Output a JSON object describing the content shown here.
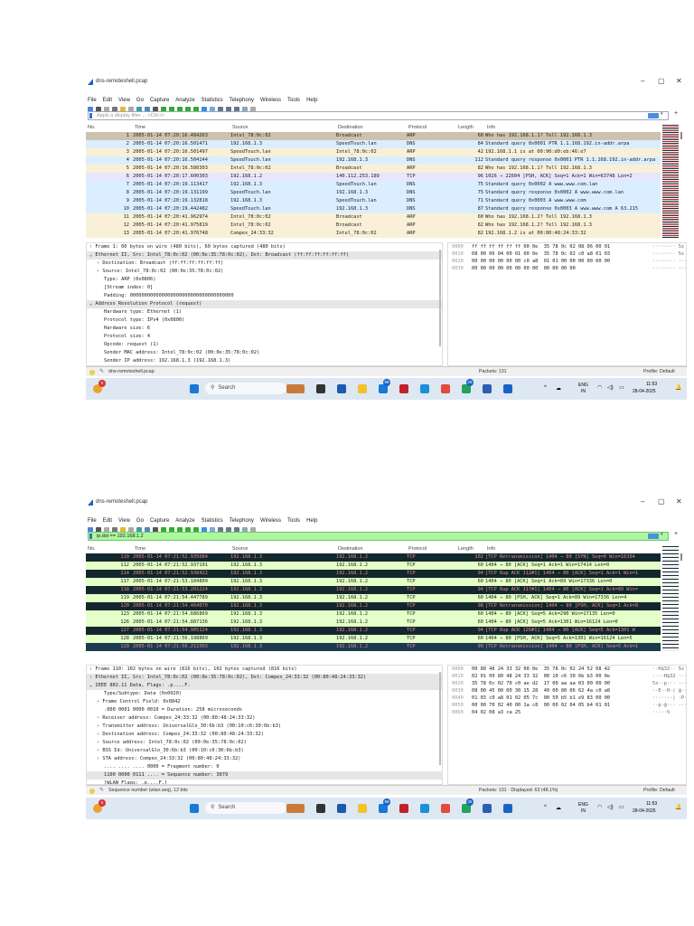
{
  "windows": [
    {
      "title": "dns-remoteshell.pcap",
      "menu": [
        "File",
        "Edit",
        "View",
        "Go",
        "Capture",
        "Analyze",
        "Statistics",
        "Telephony",
        "Wireless",
        "Tools",
        "Help"
      ],
      "filter": {
        "value": "",
        "placeholder": "Apply a display filter ... <Ctrl-/>",
        "active": false
      },
      "columns": [
        "No.",
        "Time",
        "Source",
        "Destination",
        "Protocol",
        "Length",
        "Info"
      ],
      "rows": [
        {
          "no": "1",
          "time": "2005-01-14 07:20:16.484263",
          "src": "Intel_78:0c:02",
          "dst": "Broadcast",
          "proto": "ARP",
          "len": "60",
          "info": "Who has 192.168.1.1? Tell 192.168.1.3",
          "style": "sel1"
        },
        {
          "no": "2",
          "time": "2005-01-14 07:20:16.501471",
          "src": "192.168.1.3",
          "dst": "SpeedTouch.lan",
          "proto": "DNS",
          "len": "84",
          "info": "Standard query 0x0001 PTR 1.1.168.192.in-addr.arpa",
          "style": "dns"
        },
        {
          "no": "3",
          "time": "2005-01-14 07:20:16.501497",
          "src": "SpeedTouch.lan",
          "dst": "Intel_78:0c:02",
          "proto": "ARP",
          "len": "42",
          "info": "192.168.1.1 is at 00:90:d0:eb:46:e7",
          "style": "arp"
        },
        {
          "no": "4",
          "time": "2005-01-14 07:20:16.504144",
          "src": "SpeedTouch.lan",
          "dst": "192.168.1.3",
          "proto": "DNS",
          "len": "112",
          "info": "Standard query response 0x0001 PTR 1.1.168.192.in-addr.arpa",
          "style": "dns"
        },
        {
          "no": "5",
          "time": "2005-01-14 07:20:16.580303",
          "src": "Intel_78:0c:02",
          "dst": "Broadcast",
          "proto": "ARP",
          "len": "82",
          "info": "Who has 192.168.1.1? Tell 192.168.1.3",
          "style": "arp"
        },
        {
          "no": "6",
          "time": "2005-01-14 07:20:17.600303",
          "src": "192.168.1.2",
          "dst": "140.112.253.189",
          "proto": "TCP",
          "len": "96",
          "info": "1026 → 22604 [PSH, ACK] Seq=1 Ack=1 Win=63748 Len=2",
          "style": "tcp"
        },
        {
          "no": "7",
          "time": "2005-01-14 07:20:19.113417",
          "src": "192.168.1.3",
          "dst": "SpeedTouch.lan",
          "proto": "DNS",
          "len": "75",
          "info": "Standard query 0x0002 A www.www.com.lan",
          "style": "dns"
        },
        {
          "no": "8",
          "time": "2005-01-14 07:20:19.131199",
          "src": "SpeedTouch.lan",
          "dst": "192.168.1.3",
          "proto": "DNS",
          "len": "75",
          "info": "Standard query response 0x0002 A www.www.com.lan",
          "style": "dns"
        },
        {
          "no": "9",
          "time": "2005-01-14 07:20:19.132818",
          "src": "192.168.1.3",
          "dst": "SpeedTouch.lan",
          "proto": "DNS",
          "len": "71",
          "info": "Standard query 0x0003 A www.www.com",
          "style": "dns"
        },
        {
          "no": "10",
          "time": "2005-01-14 07:20:19.442482",
          "src": "SpeedTouch.lan",
          "dst": "192.168.1.3",
          "proto": "DNS",
          "len": "87",
          "info": "Standard query response 0x0003 A www.www.com A 63.215",
          "style": "dns"
        },
        {
          "no": "11",
          "time": "2005-01-14 07:20:41.962974",
          "src": "Intel_78:0c:02",
          "dst": "Broadcast",
          "proto": "ARP",
          "len": "60",
          "info": "Who has 192.168.1.2? Tell 192.168.1.3",
          "style": "arp"
        },
        {
          "no": "12",
          "time": "2005-01-14 07:20:41.975819",
          "src": "Intel_78:0c:02",
          "dst": "Broadcast",
          "proto": "ARP",
          "len": "82",
          "info": "Who has 192.168.1.2? Tell 192.168.1.3",
          "style": "arp"
        },
        {
          "no": "13",
          "time": "2005-01-14 07:20:41.976748",
          "src": "Compex_24:33:32",
          "dst": "Intel_78:0c:02",
          "proto": "ARP",
          "len": "82",
          "info": "192.168.1.2 is at 00:80:48:24:33:32",
          "style": "arp"
        }
      ],
      "details": [
        {
          "t": "› Frame 1: 60 bytes on wire (480 bits), 60 bytes captured (480 bits)",
          "i": 0
        },
        {
          "t": "⌄ Ethernet II, Src: Intel_78:0c:02 (00:0e:35:78:0c:02), Dst: Broadcast (ff:ff:ff:ff:ff:ff)",
          "i": 0,
          "hl": true
        },
        {
          "t": "› Destination: Broadcast (ff:ff:ff:ff:ff:ff)",
          "i": 1
        },
        {
          "t": "› Source: Intel_78:0c:02 (00:0e:35:78:0c:02)",
          "i": 1
        },
        {
          "t": "Type: ARP (0x0806)",
          "i": 2
        },
        {
          "t": "[Stream index: 0]",
          "i": 2
        },
        {
          "t": "Padding: 000000000000000000000000000000000000",
          "i": 2
        },
        {
          "t": "⌄ Address Resolution Protocol (request)",
          "i": 0,
          "hl": true
        },
        {
          "t": "Hardware type: Ethernet (1)",
          "i": 2
        },
        {
          "t": "Protocol type: IPv4 (0x0800)",
          "i": 2
        },
        {
          "t": "Hardware size: 6",
          "i": 2
        },
        {
          "t": "Protocol size: 4",
          "i": 2
        },
        {
          "t": "Opcode: request (1)",
          "i": 2
        },
        {
          "t": "Sender MAC address: Intel_78:0c:02 (00:0e:35:78:0c:02)",
          "i": 2
        },
        {
          "t": "Sender IP address: 192.168.1.3 (192.168.1.3)",
          "i": 2
        }
      ],
      "hex": [
        {
          "off": "0000",
          "bytes": "ff ff ff ff ff ff 00 0e  35 78 0c 02 08 06 00 01",
          "ascii": "········ 5x"
        },
        {
          "off": "0010",
          "bytes": "08 00 06 04 00 01 00 0e  35 78 0c 02 c0 a8 01 03",
          "ascii": "········ 5x"
        },
        {
          "off": "0020",
          "bytes": "00 00 00 00 00 00 c0 a8  01 01 00 00 00 00 00 00",
          "ascii": "········ ···"
        },
        {
          "off": "0030",
          "bytes": "00 00 00 00 00 00 00 00  00 00 00 00",
          "ascii": "········ ···"
        }
      ],
      "status": {
        "left": "dns-remoteshell.pcap",
        "packets": "Packets: 131",
        "profile": "Profile: Default"
      },
      "taskbar": {
        "search": "Search",
        "lang1": "ENG",
        "lang2": "IN",
        "time": "11:53",
        "date": "28-04-2025",
        "badges": [
          "5",
          "99",
          "26"
        ]
      }
    },
    {
      "title": "dns-remoteshell.pcap",
      "menu": [
        "File",
        "Edit",
        "View",
        "Go",
        "Capture",
        "Analyze",
        "Statistics",
        "Telephony",
        "Wireless",
        "Tools",
        "Help"
      ],
      "filter": {
        "value": "ip.dst == 192.168.1.2",
        "placeholder": "",
        "active": true
      },
      "columns": [
        "No.",
        "Time",
        "Source",
        "Destination",
        "Protocol",
        "Length",
        "Info"
      ],
      "rows": [
        {
          "no": "110",
          "time": "2005-01-14 07:21:52.935084",
          "src": "192.168.1.3",
          "dst": "192.168.1.2",
          "proto": "TCP",
          "len": "102",
          "info": "[TCP Retransmission] 1404 → 80 [SYN] Seq=0 Win=16384",
          "style": "bad"
        },
        {
          "no": "112",
          "time": "2005-01-14 07:21:52.937191",
          "src": "192.168.1.3",
          "dst": "192.168.1.2",
          "proto": "TCP",
          "len": "60",
          "info": "1404 → 80 [ACK] Seq=1 Ack=1 Win=17414 Len=0",
          "style": "ok"
        },
        {
          "no": "114",
          "time": "2005-01-14 07:21:52.938422",
          "src": "192.168.1.3",
          "dst": "192.168.1.2",
          "proto": "TCP",
          "len": "94",
          "info": "[TCP Dup ACK 112#1] 1404 → 80 [ACK] Seq=1 Ack=1 Win=1",
          "style": "bad"
        },
        {
          "no": "117",
          "time": "2005-01-14 07:21:53.184809",
          "src": "192.168.1.3",
          "dst": "192.168.1.2",
          "proto": "TCP",
          "len": "60",
          "info": "1404 → 80 [ACK] Seq=1 Ack=89 Win=17336 Len=0",
          "style": "ok"
        },
        {
          "no": "118",
          "time": "2005-01-14 07:21:53.201224",
          "src": "192.168.1.3",
          "dst": "192.168.1.2",
          "proto": "TCP",
          "len": "94",
          "info": "[TCP Dup ACK 117#1] 1404 → 80 [ACK] Seq=1 Ack=89 Win=",
          "style": "bad"
        },
        {
          "no": "119",
          "time": "2005-01-14 07:21:54.447789",
          "src": "192.168.1.3",
          "dst": "192.168.1.2",
          "proto": "TCP",
          "len": "60",
          "info": "1404 → 80 [PSH, ACK] Seq=1 Ack=89 Win=17336 Len=4",
          "style": "ok"
        },
        {
          "no": "120",
          "time": "2005-01-14 07:21:54.464070",
          "src": "192.168.1.3",
          "dst": "192.168.1.2",
          "proto": "TCP",
          "len": "98",
          "info": "[TCP Retransmission] 1404 → 80 [PSH, ACK] Seq=1 Ack=8",
          "style": "bad"
        },
        {
          "no": "123",
          "time": "2005-01-14 07:21:54.686869",
          "src": "192.168.1.3",
          "dst": "192.168.1.2",
          "proto": "TCP",
          "len": "60",
          "info": "1404 → 80 [ACK] Seq=5 Ack=290 Win=17135 Len=0",
          "style": "ok"
        },
        {
          "no": "126",
          "time": "2005-01-14 07:21:54.887136",
          "src": "192.168.1.3",
          "dst": "192.168.1.2",
          "proto": "TCP",
          "len": "60",
          "info": "1404 → 80 [ACK] Seq=5 Ack=1301 Win=16124 Len=0",
          "style": "ok"
        },
        {
          "no": "127",
          "time": "2005-01-14 07:21:54.905124",
          "src": "192.168.1.3",
          "dst": "192.168.1.2",
          "proto": "TCP",
          "len": "94",
          "info": "[TCP Dup ACK 126#1] 1404 → 80 [ACK] Seq=5 Ack=1301 W",
          "style": "bad"
        },
        {
          "no": "128",
          "time": "2005-01-14 07:21:56.198869",
          "src": "192.168.1.3",
          "dst": "192.168.1.2",
          "proto": "TCP",
          "len": "60",
          "info": "1404 → 80 [PSH, ACK] Seq=5 Ack=1301 Win=16124 Len=5",
          "style": "ok"
        },
        {
          "no": "129",
          "time": "2005-01-14 07:21:56.212303",
          "src": "192.168.1.3",
          "dst": "192.168.1.2",
          "proto": "TCP",
          "len": "99",
          "info": "[TCP Retransmission] 1404 → 80 [PSH, ACK] Seq=5 Ack=1",
          "style": "sel2"
        }
      ],
      "details": [
        {
          "t": "› Frame 110: 102 bytes on wire (816 bits), 102 bytes captured (816 bits)",
          "i": 0
        },
        {
          "t": "› Ethernet II, Src: Intel_78:0c:02 (00:0e:35:78:0c:02), Dst: Compex_24:33:32 (00:80:48:24:33:32)",
          "i": 0,
          "hl": true
        },
        {
          "t": "⌄ IEEE 802.11 Data, Flags: .p....F.",
          "i": 0,
          "hl": true
        },
        {
          "t": "Type/Subtype: Data (0x0020)",
          "i": 2
        },
        {
          "t": "› Frame Control Field: 0x0842",
          "i": 1
        },
        {
          "t": ".000 0001 0000 0010 = Duration: 258 microseconds",
          "i": 2
        },
        {
          "t": "› Receiver address: Compex_24:33:32 (00:80:48:24:33:32)",
          "i": 1
        },
        {
          "t": "› Transmitter address: UniversalGlo_30:6b:b3 (00:10:c6:30:6b:b3)",
          "i": 1
        },
        {
          "t": "› Destination address: Compex_24:33:32 (00:80:48:24:33:32)",
          "i": 1
        },
        {
          "t": "› Source address: Intel_78:0c:02 (00:0e:35:78:0c:02)",
          "i": 1
        },
        {
          "t": "› BSS Id: UniversalGlo_30:6b:b3 (00:10:c6:30:6b:b3)",
          "i": 1
        },
        {
          "t": "› STA address: Compex_24:33:32 (00:80:48:24:33:32)",
          "i": 1
        },
        {
          "t": ".... .... .... 0000 = Fragment number: 0",
          "i": 2
        },
        {
          "t": "1100 0000 0111 .... = Sequence number: 3079",
          "i": 2,
          "hl": true
        },
        {
          "t": "[WLAN Flags: .p....F.]",
          "i": 2
        }
      ],
      "hex": [
        {
          "off": "0000",
          "bytes": "00 80 48 24 33 32 00 0e  35 78 0c 02 24 52 08 42",
          "ascii": "··H$32·· 5x"
        },
        {
          "off": "0010",
          "bytes": "02 01 00 80 48 24 33 32  00 10 c6 30 6b b3 00 0e",
          "ascii": "····H$32 ···0"
        },
        {
          "off": "0020",
          "bytes": "35 78 0c 02 70 c0 ae d2  17 00 aa aa 03 00 00 00",
          "ascii": "5x··p··· ····"
        },
        {
          "off": "0030",
          "bytes": "08 00 45 00 00 30 15 28  40 00 80 06 62 4a c0 a8",
          "ascii": "··E··0·( @···"
        },
        {
          "off": "0040",
          "bytes": "01 03 c0 a8 01 02 05 7c  00 50 b5 b1 e9 83 00 00",
          "ascii": "·······| ·P··"
        },
        {
          "off": "0050",
          "bytes": "00 00 70 02 40 00 1a c8  00 00 02 04 05 b4 01 01",
          "ascii": "··p·@··· ····"
        },
        {
          "off": "0060",
          "bytes": "04 02 08 a3 ca 25",
          "ascii": "·····%"
        }
      ],
      "status": {
        "left": "Sequence number (wlan.seq), 12 bits",
        "packets": "Packets: 131 · Displayed: 63 (48.1%)",
        "profile": "Profile: Default"
      },
      "taskbar": {
        "search": "Search",
        "lang1": "ENG",
        "lang2": "IN",
        "time": "11:53",
        "date": "28-04-2025",
        "badges": [
          "5",
          "99",
          "26"
        ]
      }
    }
  ],
  "colors": {
    "arp": "#faf0d7",
    "dns": "#dbeeff",
    "tcp": "#e7e6ff",
    "bad_bg": "#12272e",
    "bad_fg": "#f08888",
    "ok": "#e4ffc7",
    "filter_ok": "#b0f5a0"
  }
}
